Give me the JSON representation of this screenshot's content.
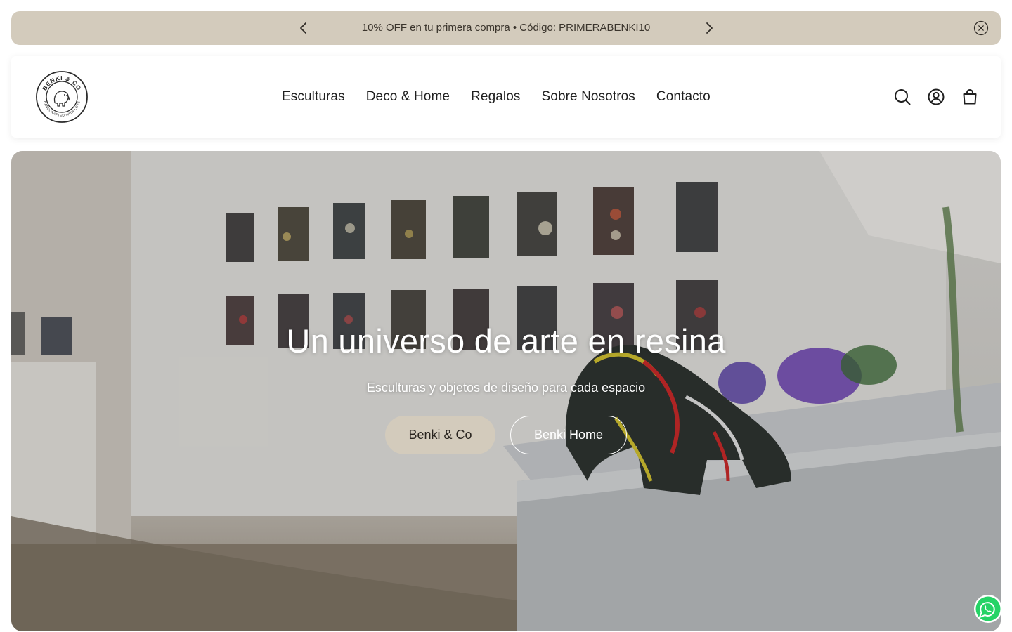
{
  "announcement": {
    "text": "10% OFF en tu primera compra • Código: PRIMERABENKI10",
    "bg_color": "#d3cbbc",
    "prev_icon": "chevron-left-icon",
    "next_icon": "chevron-right-icon",
    "close_icon": "close-circle-icon"
  },
  "header": {
    "logo": {
      "name": "BENKI & CO",
      "tagline": "HANDCRAFTED WITH LOVE"
    },
    "nav": [
      {
        "label": "Esculturas"
      },
      {
        "label": "Deco & Home"
      },
      {
        "label": "Regalos"
      },
      {
        "label": "Sobre Nosotros"
      },
      {
        "label": "Contacto"
      }
    ],
    "icons": [
      "search-icon",
      "account-icon",
      "bag-icon"
    ]
  },
  "hero": {
    "title": "Un universo de arte en resina",
    "subtitle": "Esculturas y objetos de diseño para cada espacio",
    "primary_button": "Benki & Co",
    "secondary_button": "Benki Home",
    "primary_color": "#d3cbbc"
  },
  "floating": {
    "whatsapp_icon": "whatsapp-icon",
    "whatsapp_color": "#25d366"
  }
}
